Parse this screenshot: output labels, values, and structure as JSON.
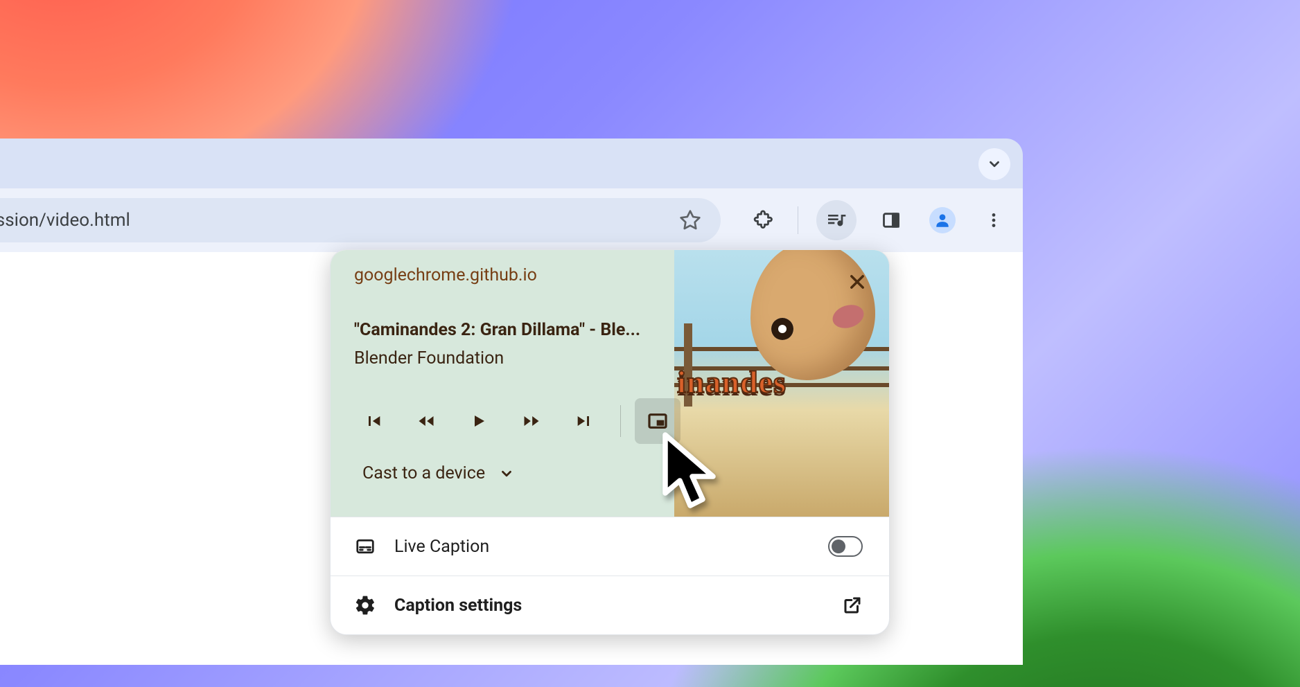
{
  "omnibox": {
    "url_fragment": "ession/video.html"
  },
  "media_popup": {
    "source": "googlechrome.github.io",
    "title": "\"Caminandes 2: Gran Dillama\" - Ble...",
    "artist": "Blender Foundation",
    "artwork_wordmark": "inandes",
    "cast_label": "Cast to a device",
    "live_caption_label": "Live Caption",
    "live_caption_on": false,
    "caption_settings_label": "Caption settings"
  },
  "icons": {
    "star": "star-icon",
    "extensions": "extensions-icon",
    "media": "media-control-icon",
    "sidepanel": "side-panel-icon",
    "profile": "profile-avatar-icon",
    "menu": "kebab-menu-icon",
    "tablist_chevron": "chevron-down-icon"
  }
}
